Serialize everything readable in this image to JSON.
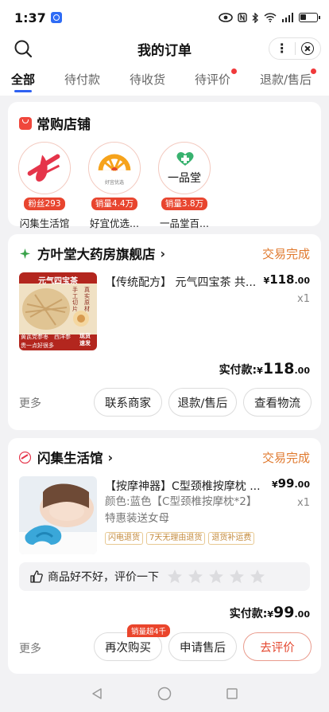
{
  "status_bar": {
    "time": "1:37",
    "battery": "battery-icon"
  },
  "header": {
    "title": "我的订单"
  },
  "tabs": [
    {
      "label": "全部",
      "active": true,
      "dot": false
    },
    {
      "label": "待付款",
      "active": false,
      "dot": false
    },
    {
      "label": "待收货",
      "active": false,
      "dot": false
    },
    {
      "label": "待评价",
      "active": false,
      "dot": true
    },
    {
      "label": "退款/售后",
      "active": false,
      "dot": true
    }
  ],
  "favorites": {
    "title": "常购店铺",
    "shops": [
      {
        "badge": "粉丝293",
        "name": "闪集生活馆"
      },
      {
        "badge": "销量4.4万",
        "name": "好宜优选...",
        "logo_text": "好宜优选"
      },
      {
        "badge": "销量3.8万",
        "name": "一品堂百...",
        "logo_text": "一品堂"
      }
    ]
  },
  "orders": [
    {
      "shop": "方叶堂大药房旗舰店",
      "status": "交易完成",
      "product_title": "【传统配方】 元气四宝茶 共...",
      "price_symbol": "¥",
      "price_int": "118",
      "price_dec": ".00",
      "qty": "x1",
      "paid_label": "实付款:",
      "paid_symbol": "¥",
      "paid_int": "118",
      "paid_dec": ".00",
      "more": "更多",
      "actions": [
        "联系商家",
        "退款/售后",
        "查看物流"
      ],
      "thumb_text": {
        "banner": "元气四宝茶",
        "side1": "手工切片",
        "side2": "真实原材",
        "bottom1": "黄芪党参枣",
        "bottom2": "西洋参",
        "bottom3": "贵一点好很多",
        "bottom4": "现货速发"
      }
    },
    {
      "shop": "闪集生活馆",
      "status": "交易完成",
      "product_title": "【按摩神器】C型颈椎按摩枕 ...",
      "price_symbol": "¥",
      "price_int": "99",
      "price_dec": ".00",
      "qty": "x1",
      "variant": "颜色:蓝色【C型颈椎按摩枕*2】特惠装送女母",
      "tags": [
        "闪电退货",
        "7天无理由退货",
        "退货补运费"
      ],
      "rate_prompt": "商品好不好，评价一下",
      "paid_label": "实付款:",
      "paid_symbol": "¥",
      "paid_int": "99",
      "paid_dec": ".00",
      "more": "更多",
      "hot_tag": "销量超4千",
      "actions": [
        "再次购买",
        "申请售后",
        "去评价"
      ]
    }
  ],
  "colors": {
    "accent": "#2f62f2",
    "status": "#e07a2f",
    "red": "#e4472f"
  }
}
